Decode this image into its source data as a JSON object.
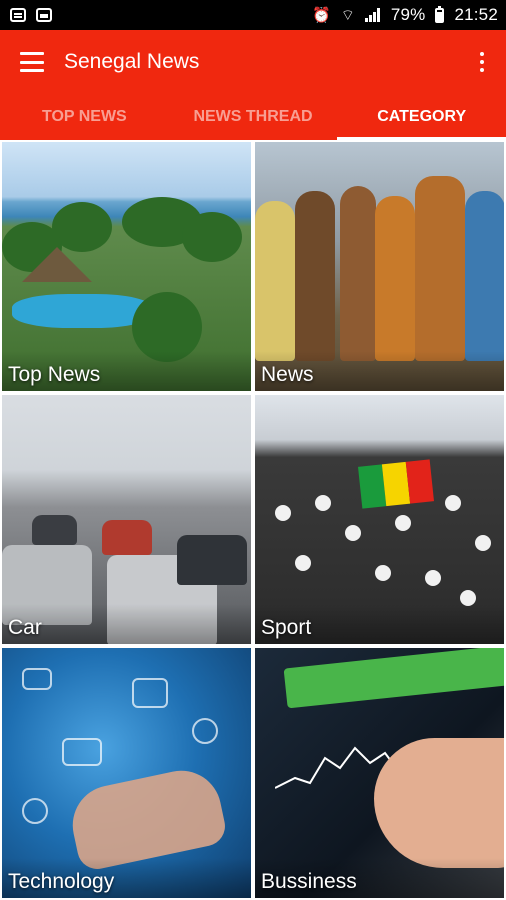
{
  "status_bar": {
    "battery": "79%",
    "time": "21:52",
    "icons": [
      "message-notification-icon",
      "image-notification-icon",
      "alarm-icon",
      "wifi-icon",
      "signal-icon",
      "battery-icon"
    ]
  },
  "app_bar": {
    "title": "Senegal News",
    "color": "#f0280f",
    "menu_icon": "hamburger-menu-icon",
    "overflow_icon": "overflow-menu-icon"
  },
  "tabs": [
    {
      "label": "TOP NEWS",
      "active": false
    },
    {
      "label": "NEWS THREAD",
      "active": false
    },
    {
      "label": "CATEGORY",
      "active": true
    }
  ],
  "categories": [
    {
      "label": "Top News"
    },
    {
      "label": "News"
    },
    {
      "label": "Car"
    },
    {
      "label": "Sport"
    },
    {
      "label": "Technology"
    },
    {
      "label": "Bussiness"
    }
  ]
}
